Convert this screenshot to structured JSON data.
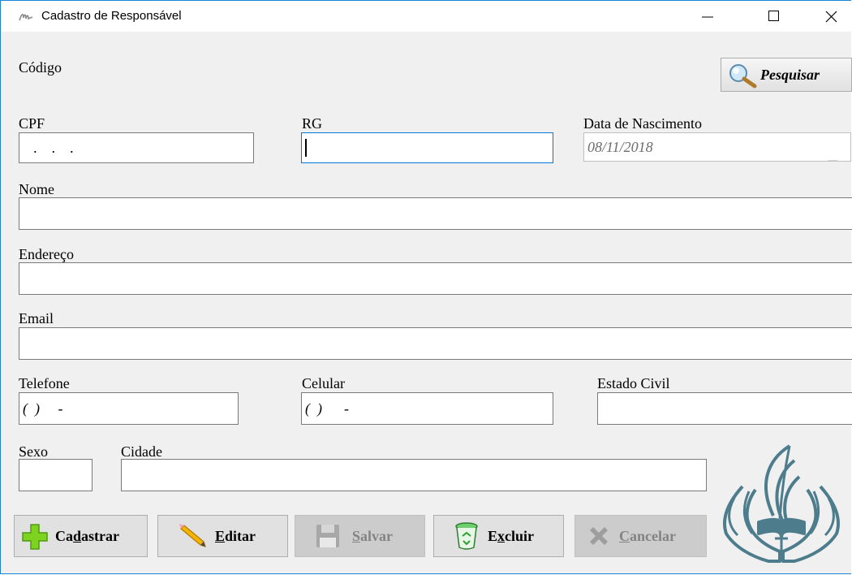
{
  "window": {
    "title": "Cadastro de Responsável",
    "icons": {
      "app": "signature-icon",
      "minimize": "minimize-icon",
      "maximize": "maximize-icon",
      "close": "close-icon"
    }
  },
  "form": {
    "codigo_label": "Código",
    "cpf_label": "CPF",
    "cpf_value": "   .    .    .",
    "rg_label": "RG",
    "rg_value": "",
    "nascimento_label": "Data de Nascimento",
    "nascimento_value": "08/11/2018",
    "nome_label": "Nome",
    "endereco_label": "Endereço",
    "email_label": "Email",
    "telefone_label": "Telefone",
    "telefone_value": "(  )     -",
    "celular_label": "Celular",
    "celular_value": "(  )      -",
    "estado_civil_label": "Estado Civil",
    "sexo_label": "Sexo",
    "cidade_label": "Cidade"
  },
  "search_button": {
    "label": "Pesquisar",
    "icon": "magnifier-icon"
  },
  "buttons": {
    "cadastrar": {
      "pre": "Ca",
      "key": "d",
      "post": "astrar",
      "icon": "green-plus-icon",
      "enabled": true
    },
    "editar": {
      "pre": "",
      "key": "E",
      "post": "ditar",
      "icon": "pencil-icon",
      "enabled": true
    },
    "salvar": {
      "pre": "",
      "key": "S",
      "post": "alvar",
      "icon": "floppy-disk-icon",
      "enabled": false
    },
    "excluir": {
      "pre": "E",
      "key": "x",
      "post": "cluir",
      "icon": "recycle-bin-icon",
      "enabled": true
    },
    "cancelar": {
      "pre": "",
      "key": "C",
      "post": "ancelar",
      "icon": "x-cancel-icon",
      "enabled": false
    }
  },
  "colors": {
    "accent": "#0078d7",
    "window_bg": "#f0f0f0",
    "logo": "#4d7d8c"
  },
  "logo_icon": "church-hands-flame-logo"
}
